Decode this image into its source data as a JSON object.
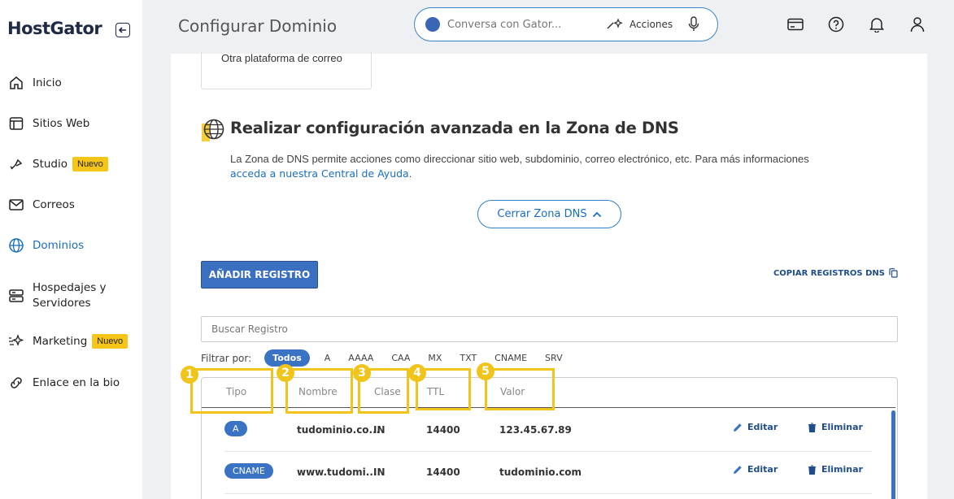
{
  "brand": {
    "name": "HostGator"
  },
  "sidebar": {
    "items": [
      {
        "label": "Inicio",
        "icon": "home-icon"
      },
      {
        "label": "Sitios Web",
        "icon": "layout-icon"
      },
      {
        "label": "Studio",
        "icon": "brush-icon",
        "badge": "Nuevo"
      },
      {
        "label": "Correos",
        "icon": "mail-icon"
      },
      {
        "label": "Dominios",
        "icon": "globe-icon",
        "active": true
      },
      {
        "label": "Hospedajes y Servidores",
        "icon": "server-icon"
      },
      {
        "label": "Marketing",
        "icon": "sparkle-icon",
        "badge": "Nuevo"
      },
      {
        "label": "Enlace en la bio",
        "icon": "link-icon"
      }
    ]
  },
  "header": {
    "title": "Configurar Dominio",
    "search_placeholder": "Conversa con Gator...",
    "actions_label": "Acciones"
  },
  "content": {
    "prev_card_label": "Otra plataforma de correo",
    "dns_title": "Realizar configuración avanzada en la Zona de DNS",
    "dns_desc": "La Zona de DNS permite acciones como direccionar sitio web, subdominio, correo electrónico, etc. Para más informaciones",
    "dns_link": "acceda a nuestra Central de Ayuda",
    "dns_period": ".",
    "close_dns": "Cerrar Zona DNS",
    "add_record": "AÑADIR REGISTRO",
    "copy_records": "COPIAR REGISTROS DNS",
    "search_records_placeholder": "Buscar Registro",
    "filter_label": "Filtrar por:",
    "filters": [
      "Todos",
      "A",
      "AAAA",
      "CAA",
      "MX",
      "TXT",
      "CNAME",
      "SRV"
    ],
    "table": {
      "headers": [
        "Tipo",
        "Nombre",
        "Clase",
        "TTL",
        "Valor"
      ],
      "rows": [
        {
          "type": "A",
          "name": "tudominio.co...",
          "class": "IN",
          "ttl": "14400",
          "value": "123.45.67.89",
          "edit": "Editar",
          "delete": "Eliminar"
        },
        {
          "type": "CNAME",
          "name": "www.tudomi...",
          "class": "IN",
          "ttl": "14400",
          "value": "tudominio.com",
          "edit": "Editar",
          "delete": "Eliminar"
        }
      ]
    },
    "markers": [
      "1",
      "2",
      "3",
      "4",
      "5"
    ]
  },
  "colors": {
    "accent": "#3b73c4",
    "badge": "#f5c518",
    "marker": "#f0c419"
  }
}
